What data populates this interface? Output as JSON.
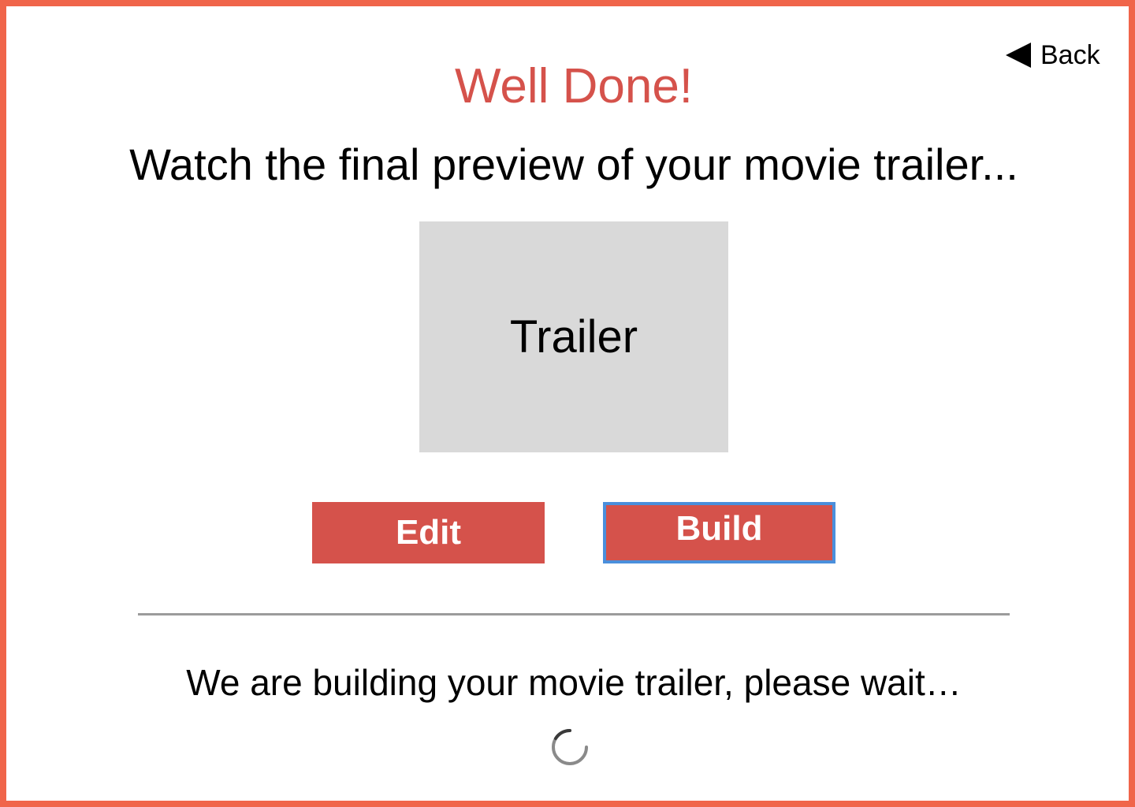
{
  "nav": {
    "back_label": "Back"
  },
  "header": {
    "title": "Well Done!",
    "subtitle": "Watch the final preview of your movie trailer..."
  },
  "preview": {
    "label": "Trailer"
  },
  "actions": {
    "edit_label": "Edit",
    "build_label": "Build"
  },
  "status": {
    "message": "We are building your movie trailer, please wait…"
  },
  "colors": {
    "border": "#f0654a",
    "accent": "#d5524b",
    "focus_ring": "#4a8fdc",
    "preview_bg": "#d9d9d9",
    "divider": "#9b9b9b"
  }
}
